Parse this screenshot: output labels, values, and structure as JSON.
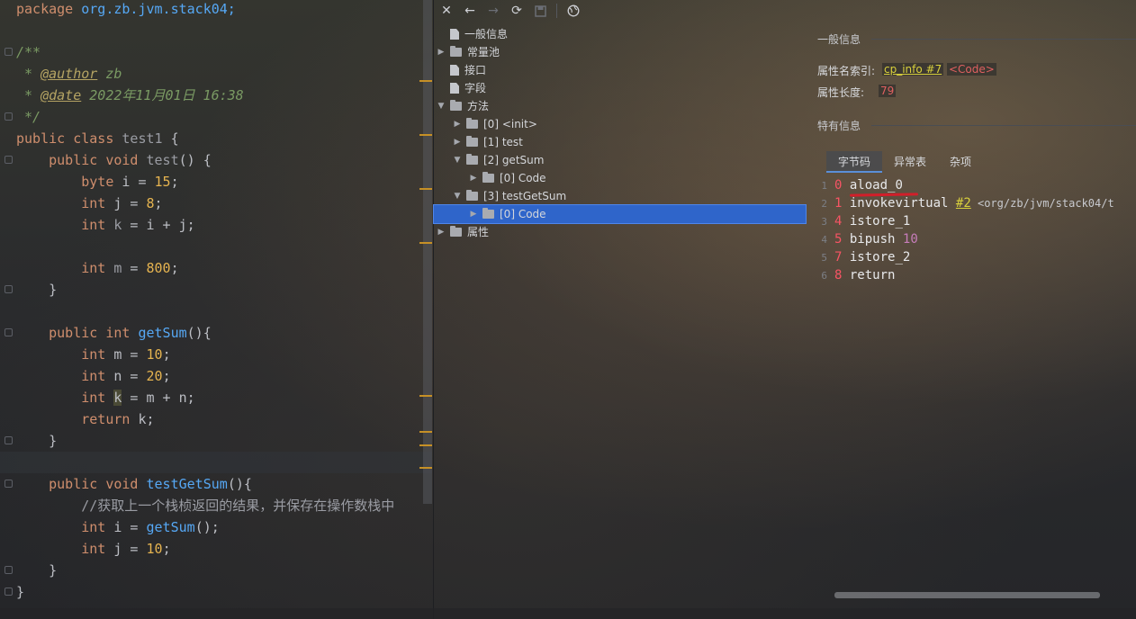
{
  "editor": {
    "lines": [
      {
        "tokens": [
          {
            "t": "package ",
            "c": "kw"
          },
          {
            "t": "org.zb.jvm.stack04;",
            "c": "fn"
          }
        ]
      },
      {
        "tokens": []
      },
      {
        "tokens": [
          {
            "t": "/**",
            "c": "cm"
          }
        ]
      },
      {
        "tokens": [
          {
            "t": " * ",
            "c": "cm"
          },
          {
            "t": "@author",
            "c": "tag"
          },
          {
            "t": " zb",
            "c": "cm"
          }
        ]
      },
      {
        "tokens": [
          {
            "t": " * ",
            "c": "cm"
          },
          {
            "t": "@date",
            "c": "tag"
          },
          {
            "t": " 2022年11月01日 16:38",
            "c": "cm"
          }
        ]
      },
      {
        "tokens": [
          {
            "t": " */",
            "c": "cm"
          }
        ]
      },
      {
        "tokens": [
          {
            "t": "public class ",
            "c": "kw"
          },
          {
            "t": "test1 ",
            "c": "gray"
          },
          {
            "t": "{",
            "c": ""
          }
        ]
      },
      {
        "tokens": [
          {
            "t": "    public void ",
            "c": "kw"
          },
          {
            "t": "test",
            "c": "gray"
          },
          {
            "t": "() {",
            "c": ""
          }
        ]
      },
      {
        "tokens": [
          {
            "t": "        byte ",
            "c": "kw"
          },
          {
            "t": "i = ",
            "c": ""
          },
          {
            "t": "15",
            "c": "num"
          },
          {
            "t": ";",
            "c": ""
          }
        ]
      },
      {
        "tokens": [
          {
            "t": "        int ",
            "c": "kw"
          },
          {
            "t": "j = ",
            "c": ""
          },
          {
            "t": "8",
            "c": "num"
          },
          {
            "t": ";",
            "c": ""
          }
        ]
      },
      {
        "tokens": [
          {
            "t": "        int ",
            "c": "kw"
          },
          {
            "t": "k",
            "c": "gray"
          },
          {
            "t": " = i + j;",
            "c": ""
          }
        ]
      },
      {
        "tokens": []
      },
      {
        "tokens": [
          {
            "t": "        int ",
            "c": "kw"
          },
          {
            "t": "m",
            "c": "gray"
          },
          {
            "t": " = ",
            "c": ""
          },
          {
            "t": "800",
            "c": "num"
          },
          {
            "t": ";",
            "c": ""
          }
        ]
      },
      {
        "tokens": [
          {
            "t": "    }",
            "c": ""
          }
        ]
      },
      {
        "tokens": []
      },
      {
        "tokens": [
          {
            "t": "    public int ",
            "c": "kw"
          },
          {
            "t": "getSum",
            "c": "fn"
          },
          {
            "t": "(){",
            "c": ""
          }
        ]
      },
      {
        "tokens": [
          {
            "t": "        int ",
            "c": "kw"
          },
          {
            "t": "m = ",
            "c": ""
          },
          {
            "t": "10",
            "c": "num"
          },
          {
            "t": ";",
            "c": ""
          }
        ]
      },
      {
        "tokens": [
          {
            "t": "        int ",
            "c": "kw"
          },
          {
            "t": "n = ",
            "c": ""
          },
          {
            "t": "20",
            "c": "num"
          },
          {
            "t": ";",
            "c": ""
          }
        ]
      },
      {
        "tokens": [
          {
            "t": "        int ",
            "c": "kw"
          },
          {
            "t": "k",
            "c": "hl"
          },
          {
            "t": " = m + n;",
            "c": ""
          }
        ]
      },
      {
        "tokens": [
          {
            "t": "        return ",
            "c": "kw"
          },
          {
            "t": "k;",
            "c": ""
          }
        ]
      },
      {
        "tokens": [
          {
            "t": "    }",
            "c": ""
          }
        ]
      },
      {
        "tokens": []
      },
      {
        "tokens": [
          {
            "t": "    public void ",
            "c": "kw"
          },
          {
            "t": "testGetSum",
            "c": "fn"
          },
          {
            "t": "(){",
            "c": ""
          }
        ]
      },
      {
        "tokens": [
          {
            "t": "        //获取上一个栈桢返回的结果，并保存在操作数栈中",
            "c": "gray"
          }
        ]
      },
      {
        "tokens": [
          {
            "t": "        int ",
            "c": "kw"
          },
          {
            "t": "i = ",
            "c": ""
          },
          {
            "t": "getSum",
            "c": "fn"
          },
          {
            "t": "();",
            "c": ""
          }
        ]
      },
      {
        "tokens": [
          {
            "t": "        int ",
            "c": "kw"
          },
          {
            "t": "j = ",
            "c": ""
          },
          {
            "t": "10",
            "c": "num"
          },
          {
            "t": ";",
            "c": ""
          }
        ]
      },
      {
        "tokens": [
          {
            "t": "    }",
            "c": ""
          }
        ]
      },
      {
        "tokens": [
          {
            "t": "}",
            "c": ""
          }
        ]
      }
    ]
  },
  "toolbar": {
    "icons": [
      "close-icon",
      "back-arrow-icon",
      "forward-arrow-icon",
      "refresh-icon",
      "save-icon",
      "globe-icon"
    ]
  },
  "tree": {
    "nodes": [
      {
        "label": "一般信息",
        "kind": "doc",
        "arrow": "",
        "depth": 0
      },
      {
        "label": "常量池",
        "kind": "folder",
        "arrow": "▶",
        "depth": 0
      },
      {
        "label": "接口",
        "kind": "doc",
        "arrow": "",
        "depth": 0
      },
      {
        "label": "字段",
        "kind": "doc",
        "arrow": "",
        "depth": 0
      },
      {
        "label": "方法",
        "kind": "folder",
        "arrow": "▼",
        "depth": 0
      },
      {
        "label": "[0] <init>",
        "kind": "folder",
        "arrow": "▶",
        "depth": 1
      },
      {
        "label": "[1] test",
        "kind": "folder",
        "arrow": "▶",
        "depth": 1
      },
      {
        "label": "[2] getSum",
        "kind": "folder",
        "arrow": "▼",
        "depth": 1
      },
      {
        "label": "[0] Code",
        "kind": "folder",
        "arrow": "▶",
        "depth": 2
      },
      {
        "label": "[3] testGetSum",
        "kind": "folder",
        "arrow": "▼",
        "depth": 1
      },
      {
        "label": "[0] Code",
        "kind": "folder",
        "arrow": "▶",
        "depth": 2,
        "selected": true
      },
      {
        "label": "属性",
        "kind": "folder",
        "arrow": "▶",
        "depth": 0
      }
    ]
  },
  "info": {
    "general_title": "一般信息",
    "attr_name_label": "属性名索引:",
    "attr_name_link": "cp_info #7",
    "attr_name_value": "<Code>",
    "attr_len_label": "属性长度:",
    "attr_len_value": "79",
    "specific_title": "特有信息",
    "tabs": [
      "字节码",
      "异常表",
      "杂项"
    ],
    "bytecode": [
      {
        "ln": "1",
        "off": "0",
        "op": "aload_0",
        "arg": "",
        "extra": ""
      },
      {
        "ln": "2",
        "off": "1",
        "op": "invokevirtual",
        "arg": "#2",
        "extra": " <org/zb/jvm/stack04/t"
      },
      {
        "ln": "3",
        "off": "4",
        "op": "istore_1",
        "arg": "",
        "extra": ""
      },
      {
        "ln": "4",
        "off": "5",
        "op": "bipush",
        "arg": "10",
        "extra": ""
      },
      {
        "ln": "5",
        "off": "7",
        "op": "istore_2",
        "arg": "",
        "extra": ""
      },
      {
        "ln": "6",
        "off": "8",
        "op": "return",
        "arg": "",
        "extra": ""
      }
    ]
  }
}
